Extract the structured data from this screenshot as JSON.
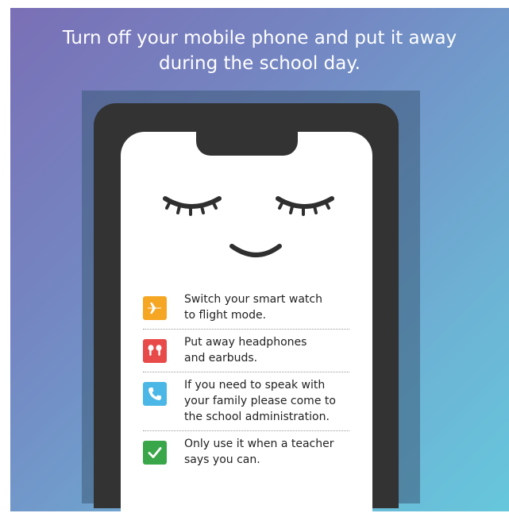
{
  "title": {
    "line1": "Turn off your mobile phone and put it away",
    "line2": "during the school day."
  },
  "tips": [
    {
      "icon": "airplane-icon",
      "color": "#f5a623",
      "text": "Switch your smart watch\nto flight mode."
    },
    {
      "icon": "earbuds-icon",
      "color": "#e84a4a",
      "text": "Put away headphones\nand earbuds."
    },
    {
      "icon": "phone-icon",
      "color": "#4ab7e6",
      "text": "If you need to speak with\nyour family please come to\nthe school administration."
    },
    {
      "icon": "checkmark-icon",
      "color": "#3aa64a",
      "text": "Only use it when a teacher\nsays you can."
    }
  ],
  "colors": {
    "gradient_start": "#7a6fb6",
    "gradient_end": "#66c7dc",
    "phone_body": "#333333"
  }
}
